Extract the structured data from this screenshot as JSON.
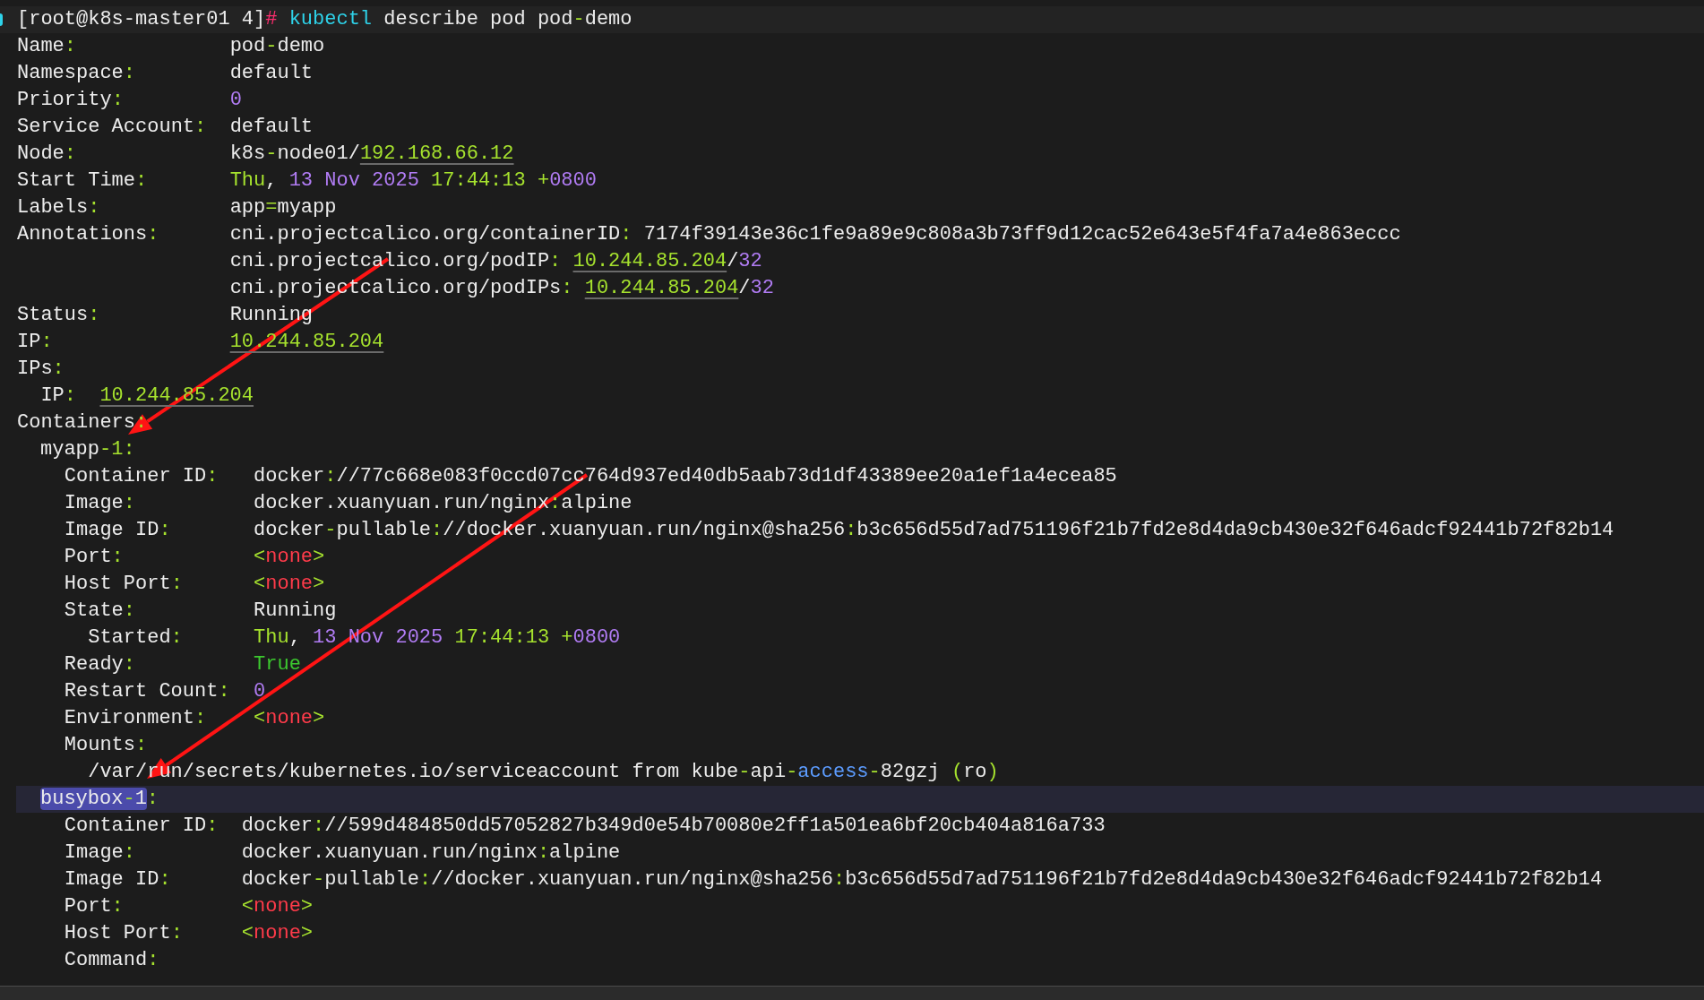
{
  "prompt_line": [
    {
      "text": "[root@k8s-master01 4]"
    },
    {
      "text": "#",
      "kind": "prompt"
    },
    {
      "text": " kubectl",
      "kind": "command"
    },
    {
      "text": " describe pod pod"
    },
    {
      "text": "-",
      "kind": "accent"
    },
    {
      "text": "demo"
    }
  ],
  "fields": [
    {
      "key": [
        {
          "text": "Name"
        },
        {
          "text": ":",
          "kind": "accent"
        }
      ],
      "values": [
        [
          {
            "text": "pod"
          },
          {
            "text": "-",
            "kind": "accent"
          },
          {
            "text": "demo"
          }
        ]
      ]
    },
    {
      "key": [
        {
          "text": "Namespace"
        },
        {
          "text": ":",
          "kind": "accent"
        }
      ],
      "values": [
        [
          {
            "text": "default"
          }
        ]
      ]
    },
    {
      "key": [
        {
          "text": "Priority"
        },
        {
          "text": ":",
          "kind": "accent"
        }
      ],
      "values": [
        [
          {
            "text": "0",
            "kind": "number"
          }
        ]
      ]
    },
    {
      "key": [
        {
          "text": "Service Account"
        },
        {
          "text": ":",
          "kind": "accent"
        }
      ],
      "values": [
        [
          {
            "text": "default"
          }
        ]
      ]
    },
    {
      "key": [
        {
          "text": "Node"
        },
        {
          "text": ":",
          "kind": "accent"
        }
      ],
      "values": [
        [
          {
            "text": "k8s"
          },
          {
            "text": "-",
            "kind": "accent"
          },
          {
            "text": "node01/"
          },
          {
            "text": "192.168.66.12",
            "kind": "address"
          }
        ]
      ]
    },
    {
      "key": [
        {
          "text": "Start Time"
        },
        {
          "text": ":",
          "kind": "accent"
        }
      ],
      "values": [
        [
          {
            "text": "Thu",
            "kind": "accent"
          },
          {
            "text": ", "
          },
          {
            "text": "13 Nov 2025",
            "kind": "number"
          },
          {
            "text": " 17:44:13 +",
            "kind": "accent"
          },
          {
            "text": "0800",
            "kind": "number"
          }
        ]
      ]
    },
    {
      "key": [
        {
          "text": "Labels"
        },
        {
          "text": ":",
          "kind": "accent"
        }
      ],
      "values": [
        [
          {
            "text": "app"
          },
          {
            "text": "=",
            "kind": "accent"
          },
          {
            "text": "myapp"
          }
        ]
      ]
    },
    {
      "key": [
        {
          "text": "Annotations"
        },
        {
          "text": ":",
          "kind": "accent"
        }
      ],
      "values": [
        [
          {
            "text": "cni.projectcalico.org/containerID"
          },
          {
            "text": ":",
            "kind": "accent"
          },
          {
            "text": " 7174f39143e36c1fe9a89e9c808a3b73ff9d12cac52e643e5f4fa7a4e863eccc"
          }
        ],
        [
          {
            "text": "cni.projectcalico.org/podIP"
          },
          {
            "text": ": ",
            "kind": "accent"
          },
          {
            "text": "10.244.85.204",
            "kind": "address"
          },
          {
            "text": "/"
          },
          {
            "text": "32",
            "kind": "number"
          }
        ],
        [
          {
            "text": "cni.projectcalico.org/podIPs"
          },
          {
            "text": ": ",
            "kind": "accent"
          },
          {
            "text": "10.244.85.204",
            "kind": "address"
          },
          {
            "text": "/"
          },
          {
            "text": "32",
            "kind": "number"
          }
        ]
      ]
    },
    {
      "key": [
        {
          "text": "Status"
        },
        {
          "text": ":",
          "kind": "accent"
        }
      ],
      "values": [
        [
          {
            "text": "Running"
          }
        ]
      ]
    },
    {
      "key": [
        {
          "text": "IP"
        },
        {
          "text": ":",
          "kind": "accent"
        }
      ],
      "values": [
        [
          {
            "text": "10.244.85.204",
            "kind": "address"
          }
        ]
      ]
    },
    {
      "key": [
        {
          "text": "IPs"
        },
        {
          "text": ":",
          "kind": "accent"
        }
      ],
      "children": [
        {
          "key": [
            {
              "text": "IP"
            },
            {
              "text": ":",
              "kind": "accent"
            }
          ],
          "values": [
            [
              {
                "text": "10.244.85.204",
                "kind": "address"
              }
            ]
          ]
        }
      ]
    },
    {
      "key": [
        {
          "text": "Containers"
        },
        {
          "text": ":",
          "kind": "accent"
        }
      ],
      "containers": [
        {
          "name": [
            {
              "text": "myapp"
            },
            {
              "text": "-1:",
              "kind": "accent"
            }
          ],
          "selected": false,
          "fields": [
            {
              "key": [
                {
                  "text": "Container ID"
                },
                {
                  "text": ":",
                  "kind": "accent"
                }
              ],
              "values": [
                [
                  {
                    "text": "docker"
                  },
                  {
                    "text": ":",
                    "kind": "accent"
                  },
                  {
                    "text": "//77c668e083f0ccd07cc764d937ed40db5aab73d1df43389ee20a1ef1a4ecea85"
                  }
                ]
              ]
            },
            {
              "key": [
                {
                  "text": "Image"
                },
                {
                  "text": ":",
                  "kind": "accent"
                }
              ],
              "values": [
                [
                  {
                    "text": "docker.xuanyuan.run/nginx"
                  },
                  {
                    "text": ":",
                    "kind": "accent"
                  },
                  {
                    "text": "alpine"
                  }
                ]
              ]
            },
            {
              "key": [
                {
                  "text": "Image ID"
                },
                {
                  "text": ":",
                  "kind": "accent"
                }
              ],
              "values": [
                [
                  {
                    "text": "docker"
                  },
                  {
                    "text": "-",
                    "kind": "accent"
                  },
                  {
                    "text": "pullable"
                  },
                  {
                    "text": ":",
                    "kind": "accent"
                  },
                  {
                    "text": "//docker.xuanyuan.run/nginx@sha256"
                  },
                  {
                    "text": ":",
                    "kind": "accent"
                  },
                  {
                    "text": "b3c656d55d7ad751196f21b7fd2e8d4da9cb430e32f646adcf92441b72f82b14"
                  }
                ]
              ]
            },
            {
              "key": [
                {
                  "text": "Port"
                },
                {
                  "text": ":",
                  "kind": "accent"
                }
              ],
              "values": [
                [
                  {
                    "text": "<",
                    "kind": "accent"
                  },
                  {
                    "text": "none",
                    "kind": "error"
                  },
                  {
                    "text": ">",
                    "kind": "accent"
                  }
                ]
              ]
            },
            {
              "key": [
                {
                  "text": "Host Port"
                },
                {
                  "text": ":",
                  "kind": "accent"
                }
              ],
              "values": [
                [
                  {
                    "text": "<",
                    "kind": "accent"
                  },
                  {
                    "text": "none",
                    "kind": "error"
                  },
                  {
                    "text": ">",
                    "kind": "accent"
                  }
                ]
              ]
            },
            {
              "key": [
                {
                  "text": "State"
                },
                {
                  "text": ":",
                  "kind": "accent"
                }
              ],
              "values": [
                [
                  {
                    "text": "Running"
                  }
                ]
              ],
              "children": [
                {
                  "key": [
                    {
                      "text": "Started"
                    },
                    {
                      "text": ":",
                      "kind": "accent"
                    }
                  ],
                  "values": [
                    [
                      {
                        "text": "Thu",
                        "kind": "accent"
                      },
                      {
                        "text": ", "
                      },
                      {
                        "text": "13 Nov 2025",
                        "kind": "number"
                      },
                      {
                        "text": " 17:44:13 +",
                        "kind": "accent"
                      },
                      {
                        "text": "0800",
                        "kind": "number"
                      }
                    ]
                  ]
                }
              ]
            },
            {
              "key": [
                {
                  "text": "Ready"
                },
                {
                  "text": ":",
                  "kind": "accent"
                }
              ],
              "values": [
                [
                  {
                    "text": "True",
                    "kind": "success"
                  }
                ]
              ]
            },
            {
              "key": [
                {
                  "text": "Restart Count"
                },
                {
                  "text": ":",
                  "kind": "accent"
                }
              ],
              "values": [
                [
                  {
                    "text": "0",
                    "kind": "number"
                  }
                ]
              ]
            },
            {
              "key": [
                {
                  "text": "Environment"
                },
                {
                  "text": ":",
                  "kind": "accent"
                }
              ],
              "values": [
                [
                  {
                    "text": "<",
                    "kind": "accent"
                  },
                  {
                    "text": "none",
                    "kind": "error"
                  },
                  {
                    "text": ">",
                    "kind": "accent"
                  }
                ]
              ]
            },
            {
              "key": [
                {
                  "text": "Mounts"
                },
                {
                  "text": ":",
                  "kind": "accent"
                }
              ],
              "items": [
                [
                  {
                    "text": "/var/run/secrets/kubernetes.io/serviceaccount from kube"
                  },
                  {
                    "text": "-",
                    "kind": "accent"
                  },
                  {
                    "text": "api"
                  },
                  {
                    "text": "-",
                    "kind": "accent"
                  },
                  {
                    "text": "access",
                    "kind": "keyword"
                  },
                  {
                    "text": "-",
                    "kind": "accent"
                  },
                  {
                    "text": "82gzj "
                  },
                  {
                    "text": "(",
                    "kind": "accent"
                  },
                  {
                    "text": "ro"
                  },
                  {
                    "text": ")",
                    "kind": "accent"
                  }
                ]
              ]
            }
          ]
        },
        {
          "name": [
            {
              "text": "busybox"
            },
            {
              "text": "-",
              "kind": "accent"
            },
            {
              "text": "1"
            }
          ],
          "colon": [
            {
              "text": ":",
              "kind": "accent"
            }
          ],
          "selected": true,
          "fields": [
            {
              "key": [
                {
                  "text": "Container ID"
                },
                {
                  "text": ":",
                  "kind": "accent"
                }
              ],
              "values": [
                [
                  {
                    "text": "docker"
                  },
                  {
                    "text": ":",
                    "kind": "accent"
                  },
                  {
                    "text": "//599d484850dd57052827b349d0e54b70080e2ff1a501ea6bf20cb404a816a733"
                  }
                ]
              ]
            },
            {
              "key": [
                {
                  "text": "Image"
                },
                {
                  "text": ":",
                  "kind": "accent"
                }
              ],
              "values": [
                [
                  {
                    "text": "docker.xuanyuan.run/nginx"
                  },
                  {
                    "text": ":",
                    "kind": "accent"
                  },
                  {
                    "text": "alpine"
                  }
                ]
              ]
            },
            {
              "key": [
                {
                  "text": "Image ID"
                },
                {
                  "text": ":",
                  "kind": "accent"
                }
              ],
              "values": [
                [
                  {
                    "text": "docker"
                  },
                  {
                    "text": "-",
                    "kind": "accent"
                  },
                  {
                    "text": "pullable"
                  },
                  {
                    "text": ":",
                    "kind": "accent"
                  },
                  {
                    "text": "//docker.xuanyuan.run/nginx@sha256"
                  },
                  {
                    "text": ":",
                    "kind": "accent"
                  },
                  {
                    "text": "b3c656d55d7ad751196f21b7fd2e8d4da9cb430e32f646adcf92441b72f82b14"
                  }
                ]
              ]
            },
            {
              "key": [
                {
                  "text": "Port"
                },
                {
                  "text": ":",
                  "kind": "accent"
                }
              ],
              "values": [
                [
                  {
                    "text": "<",
                    "kind": "accent"
                  },
                  {
                    "text": "none",
                    "kind": "error"
                  },
                  {
                    "text": ">",
                    "kind": "accent"
                  }
                ]
              ]
            },
            {
              "key": [
                {
                  "text": "Host Port"
                },
                {
                  "text": ":",
                  "kind": "accent"
                }
              ],
              "values": [
                [
                  {
                    "text": "<",
                    "kind": "accent"
                  },
                  {
                    "text": "none",
                    "kind": "error"
                  },
                  {
                    "text": ">",
                    "kind": "accent"
                  }
                ]
              ]
            },
            {
              "key": [
                {
                  "text": "Command"
                },
                {
                  "text": ":",
                  "kind": "accent"
                }
              ]
            }
          ]
        }
      ]
    }
  ]
}
